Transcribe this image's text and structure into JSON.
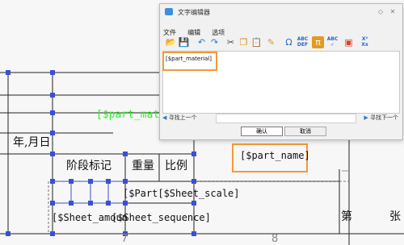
{
  "drawing": {
    "part_material_label": "[$part_material]",
    "year_month_day": "年,月日",
    "stage_mark": "阶段标记",
    "weight": "重量",
    "scale": "比例",
    "part_name_label": "[$part_name]",
    "sheet_scale_label": "[$Part[$Sheet_scale]",
    "sheet_amount_label": "[$Sheet_amoun",
    "sheet_sequence_label": "[$Sheet_sequence]",
    "di": "第",
    "zhang": "张",
    "ruler_seven": "7",
    "ruler_eight": "8"
  },
  "dialog": {
    "title": "文字编辑器",
    "menu": [
      "文件",
      "编辑",
      "选项"
    ],
    "toolbar_icons": [
      "folder-open-icon",
      "save-icon",
      "undo-icon",
      "redo-icon",
      "cut-icon",
      "copy-icon",
      "paste-icon",
      "clear-icon",
      "omega-icon",
      "abc-def-icon",
      "pi-icon",
      "spell-check-icon",
      "image-icon",
      "subscript-icon"
    ],
    "editor_text": "[$part_material]",
    "find_prev": "寻找上一个",
    "find_next": "寻找下一个",
    "find_value": "",
    "ok": "确认",
    "cancel": "取消",
    "accent_color": "#f29a3a"
  }
}
